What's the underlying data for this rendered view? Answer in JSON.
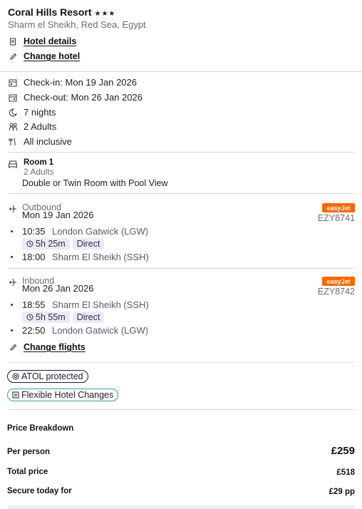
{
  "hotel": {
    "name": "Coral Hills Resort",
    "stars": "★★★",
    "location": "Sharm el Sheikh, Red Sea, Egypt",
    "details_link": "Hotel details",
    "change_link": "Change hotel"
  },
  "stay": {
    "checkin": "Check-in: Mon 19 Jan 2026",
    "checkout": "Check-out: Mon 26 Jan 2026",
    "nights": "7 nights",
    "guests": "2 Adults",
    "board": "All inclusive"
  },
  "room": {
    "title": "Room 1",
    "guests": "2 Adults",
    "type": "Double or Twin Room with Pool View"
  },
  "outbound": {
    "label": "Outbound",
    "date": "Mon 19 Jan 2026",
    "airline": "easyJet",
    "flight_no": "EZY8741",
    "dep_time": "10:35",
    "dep_airport": "London Gatwick (LGW)",
    "duration": "5h 25m",
    "stops": "Direct",
    "arr_time": "18:00",
    "arr_airport": "Sharm El Sheikh (SSH)"
  },
  "inbound": {
    "label": "Inbound",
    "date": "Mon 26 Jan 2026",
    "airline": "easyJet",
    "flight_no": "EZY8742",
    "dep_time": "18:55",
    "dep_airport": "Sharm El Sheikh (SSH)",
    "duration": "5h 55m",
    "stops": "Direct",
    "arr_time": "22:50",
    "arr_airport": "London Gatwick (LGW)"
  },
  "change_flights": "Change flights",
  "badges": {
    "atol": "ATOL protected",
    "flexible": "Flexible Hotel Changes"
  },
  "price": {
    "heading": "Price Breakdown",
    "per_person_label": "Per person",
    "per_person": "£259",
    "total_label": "Total price",
    "total": "£518",
    "secure_label": "Secure today for",
    "secure": "£29 pp"
  },
  "colors": {
    "easyjet": "#ff6600",
    "flexible_border": "#3aa776",
    "pill_bg": "#eceaf6"
  }
}
